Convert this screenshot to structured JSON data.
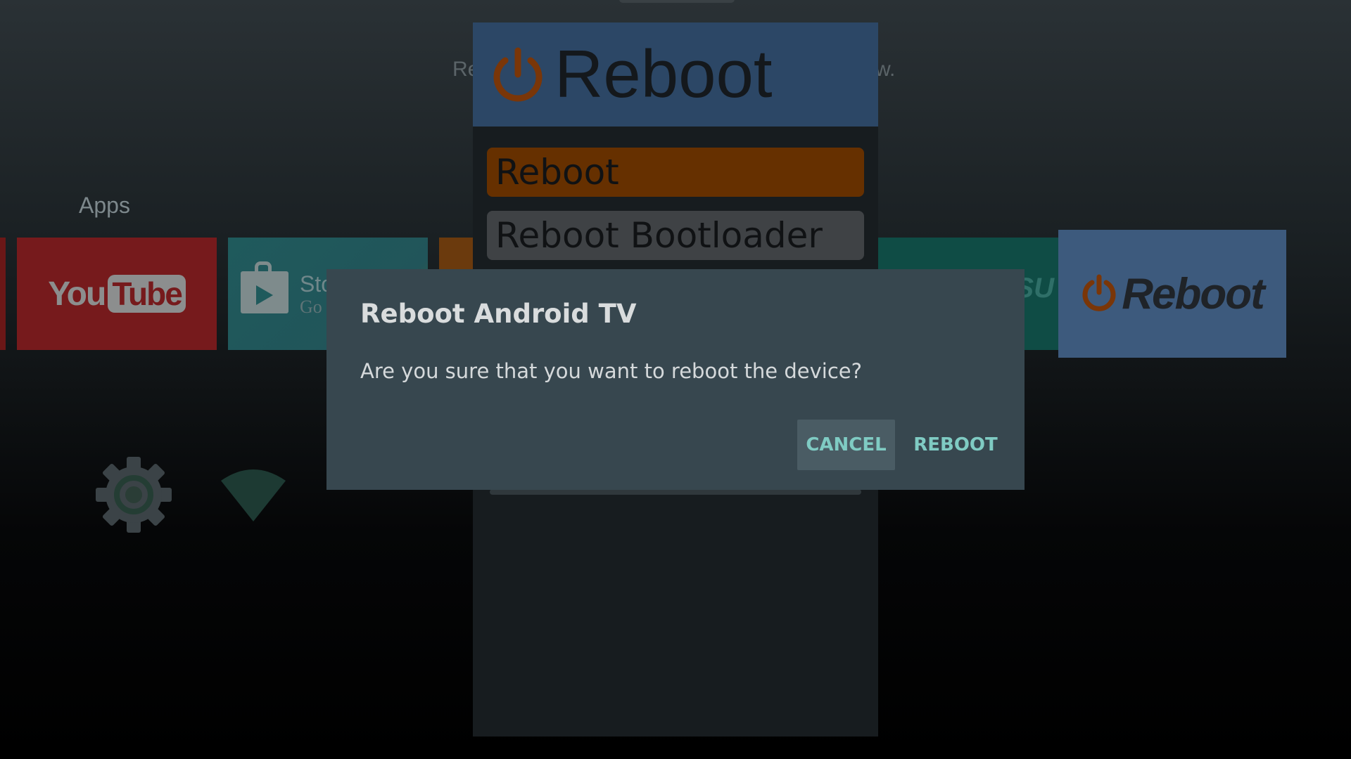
{
  "background": {
    "hint_left": "Re",
    "hint_right": "w.",
    "apps_row": {
      "label": "Apps",
      "tiles": [
        {
          "name": "youtube",
          "you": "You",
          "tube": "Tube"
        },
        {
          "name": "store",
          "line1": "Sto",
          "line2": "Go"
        },
        {
          "name": "partial-orange"
        },
        {
          "name": "partial-teal",
          "text": "SU"
        },
        {
          "name": "reboot",
          "text": "Reboot",
          "icon": "power-icon"
        }
      ]
    },
    "system_icons": [
      "gear-icon",
      "wifi-icon"
    ]
  },
  "app_panel": {
    "title": "Reboot",
    "title_icon": "power-icon",
    "menu": [
      {
        "label": "Reboot",
        "state": "focused"
      },
      {
        "label": "Reboot Bootloader"
      }
    ]
  },
  "dialog": {
    "title": "Reboot Android TV",
    "message": "Are you sure that you want to reboot the device?",
    "cancel_label": "CANCEL",
    "confirm_label": "REBOOT"
  },
  "colors": {
    "dialog_bg": "#37474f",
    "dialog_button_text": "#7fcbc3",
    "header_bg": "#2c4766",
    "focused_item": "#663000",
    "power_icon": "#7a3608"
  }
}
